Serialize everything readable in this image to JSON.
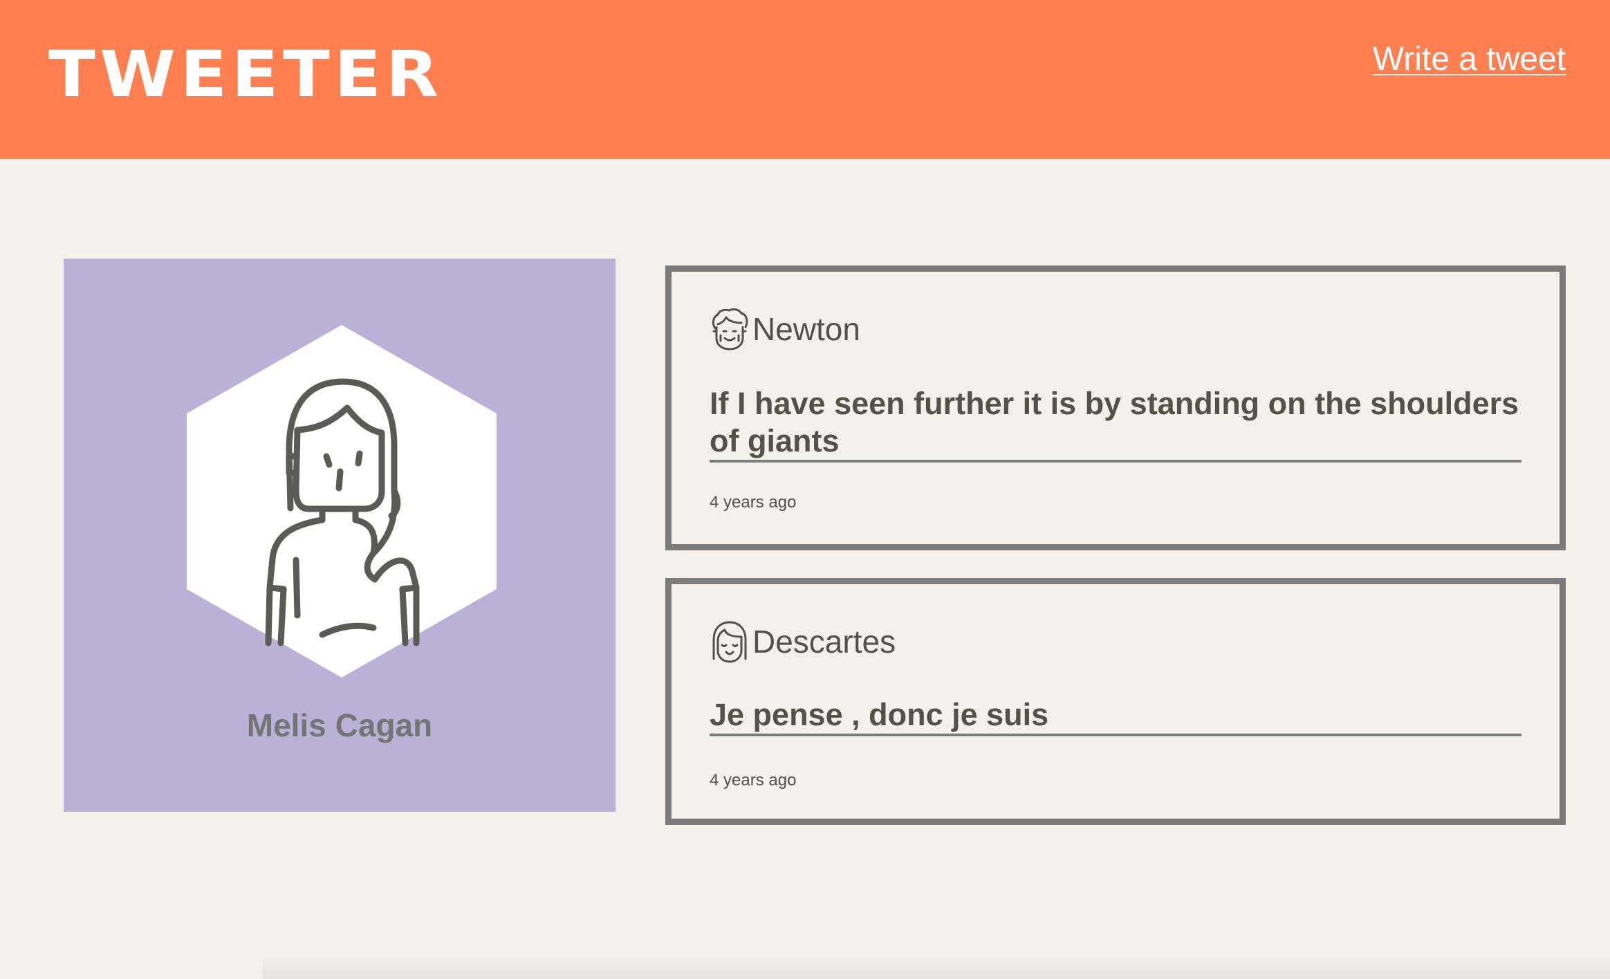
{
  "header": {
    "logo": "TWEETER",
    "write_link": "Write a tweet"
  },
  "profile": {
    "name": "Melis Cagan",
    "avatar_icon": "user-avatar-icon"
  },
  "tweets": [
    {
      "author": "Newton",
      "avatar_icon": "curly-hair-avatar-icon",
      "text": "If I have seen further it is by standing on the shoulders of giants",
      "time": "4 years ago"
    },
    {
      "author": "Descartes",
      "avatar_icon": "bangs-avatar-icon",
      "text": "Je pense , donc je suis",
      "time": "4 years ago"
    }
  ],
  "colors": {
    "header_bg": "#ff7f50",
    "page_bg": "#f4f1ec",
    "profile_bg": "#bbb0d6",
    "text": "#545149",
    "border": "#7b7b7a"
  }
}
